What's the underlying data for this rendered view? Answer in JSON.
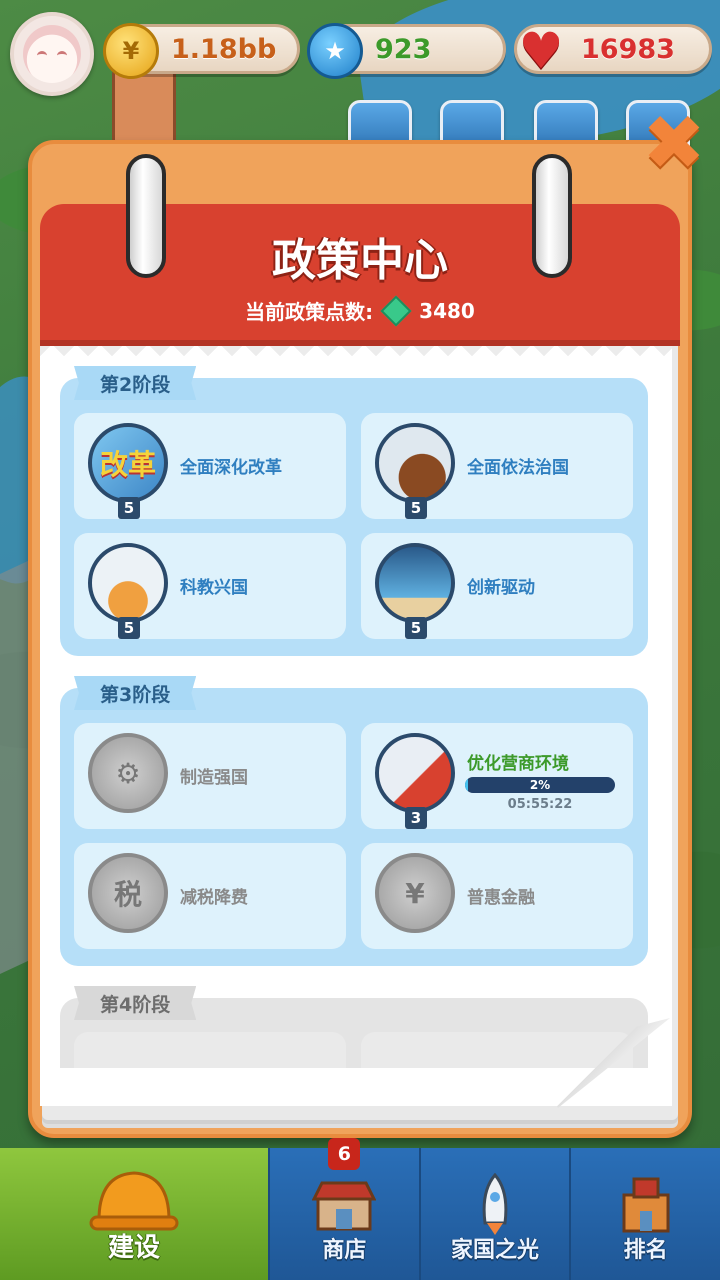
{
  "hud": {
    "coins": "1.18bb",
    "stars": "923",
    "hearts": "16983"
  },
  "panel": {
    "title": "政策中心",
    "points_label": "当前政策点数:",
    "points_value": "3480"
  },
  "stages": [
    {
      "label": "第2阶段",
      "locked": false,
      "cards": [
        {
          "name": "全面深化改革",
          "level": "5",
          "badge_text": "改革",
          "status": "unlocked"
        },
        {
          "name": "全面依法治国",
          "level": "5",
          "status": "unlocked"
        },
        {
          "name": "科教兴国",
          "level": "5",
          "status": "unlocked"
        },
        {
          "name": "创新驱动",
          "level": "5",
          "status": "unlocked"
        }
      ]
    },
    {
      "label": "第3阶段",
      "locked": false,
      "cards": [
        {
          "name": "制造强国",
          "status": "locked"
        },
        {
          "name": "优化营商环境",
          "level": "3",
          "status": "in-progress",
          "progress_percent": 2,
          "progress_label": "2%",
          "timer": "05:55:22"
        },
        {
          "name": "减税降费",
          "badge_text": "税",
          "status": "locked"
        },
        {
          "name": "普惠金融",
          "status": "locked"
        }
      ]
    },
    {
      "label": "第4阶段",
      "locked": true
    }
  ],
  "nav": {
    "items": [
      {
        "label": "建设",
        "active": true
      },
      {
        "label": "商店",
        "badge": "6"
      },
      {
        "label": "家国之光"
      },
      {
        "label": "排名"
      }
    ]
  },
  "colors": {
    "header_red": "#d8412f",
    "panel_orange": "#f0a35b",
    "stage_blue": "#b6dff8",
    "nav_blue": "#2a6fb8",
    "nav_active_green": "#8fc73e"
  }
}
